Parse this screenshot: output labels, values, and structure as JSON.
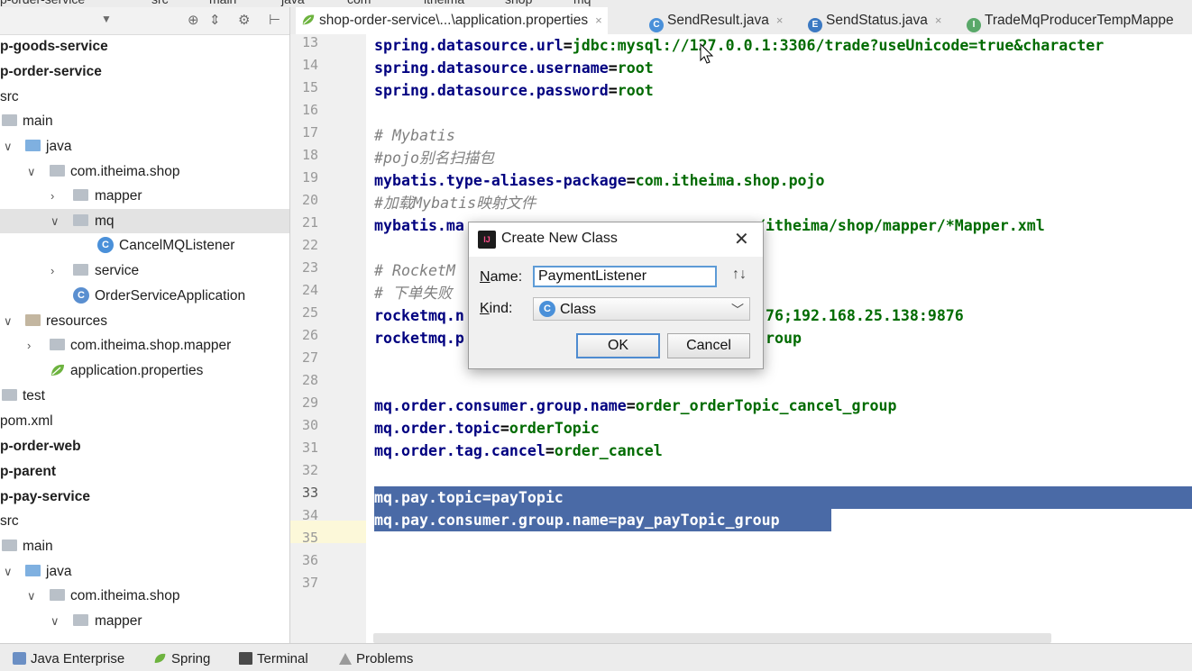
{
  "top_strip": {
    "crumbs": [
      "p-order-service",
      "src",
      "main",
      "java",
      "com",
      "itheima",
      "shop",
      "mq"
    ]
  },
  "project": {
    "tree": [
      {
        "label": "p-goods-service",
        "bold": true
      },
      {
        "label": "p-order-service",
        "bold": true
      },
      {
        "label": "src"
      },
      {
        "label": "main"
      },
      {
        "label": "java"
      },
      {
        "label": "com.itheima.shop"
      },
      {
        "label": "mapper"
      },
      {
        "label": "mq"
      },
      {
        "label": "CancelMQListener"
      },
      {
        "label": "service"
      },
      {
        "label": "OrderServiceApplication"
      },
      {
        "label": "resources"
      },
      {
        "label": "com.itheima.shop.mapper"
      },
      {
        "label": "application.properties"
      },
      {
        "label": "test"
      },
      {
        "label": "pom.xml"
      },
      {
        "label": "p-order-web",
        "bold": true
      },
      {
        "label": "p-parent",
        "bold": true
      },
      {
        "label": "p-pay-service",
        "bold": true
      },
      {
        "label": "src"
      },
      {
        "label": "main"
      },
      {
        "label": "java"
      },
      {
        "label": "com.itheima.shop"
      },
      {
        "label": "mapper"
      }
    ]
  },
  "editor_tabs": [
    {
      "label": "shop-order-service\\...\\application.properties",
      "close": "×"
    },
    {
      "label": "SendResult.java",
      "close": "×"
    },
    {
      "label": "SendStatus.java",
      "close": "×"
    },
    {
      "label": "TradeMqProducerTempMappe"
    }
  ],
  "gutter": {
    "lines": [
      "13",
      "14",
      "15",
      "16",
      "17",
      "18",
      "19",
      "20",
      "21",
      "22",
      "23",
      "24",
      "25",
      "26",
      "27",
      "28",
      "29",
      "30",
      "31",
      "32",
      "33",
      "34",
      "35",
      "36",
      "37"
    ]
  },
  "code": {
    "l13": {
      "k": "spring.datasource.url",
      "e": "=",
      "v": "jdbc:mysql://127.0.0.1:3306/trade?useUnicode=true&character"
    },
    "l14": {
      "k": "spring.datasource.username",
      "e": "=",
      "v": "root"
    },
    "l15": {
      "k": "spring.datasource.password",
      "e": "=",
      "v": "root"
    },
    "l17": "# Mybatis",
    "l18": "#pojo别名扫描包",
    "l19": {
      "k": "mybatis.type-aliases-package",
      "e": "=",
      "v": "com.itheima.shop.pojo"
    },
    "l20": "#加载Mybatis映射文件",
    "l21a": "mybatis.ma",
    "l21b": "/itheima/shop/mapper/*Mapper.xml",
    "l23": "# RocketM",
    "l24": "# 下单失败",
    "l25a": "rocketmq.n",
    "l25b": "76;192.168.25.138:9876",
    "l26a": "rocketmq.p",
    "l26b": "roup",
    "l29": {
      "k": "mq.order.consumer.group.name",
      "e": "=",
      "v": "order_orderTopic_cancel_group"
    },
    "l30": {
      "k": "mq.order.topic",
      "e": "=",
      "v": "orderTopic"
    },
    "l31": {
      "k": "mq.order.tag.cancel",
      "e": "=",
      "v": "order_cancel"
    },
    "l33": "mq.pay.topic=payTopic",
    "l34": "mq.pay.consumer.group.name=pay_payTopic_group"
  },
  "dialog": {
    "title": "Create New Class",
    "name_label": "ame:",
    "name_mnemonic": "N",
    "name_value": "PaymentListener",
    "kind_label": "ind:",
    "kind_mnemonic": "K",
    "kind_value": "Class",
    "ok_label": "OK",
    "cancel_label": "Cancel",
    "class_badge": "C"
  },
  "bottom_bar": {
    "items": [
      "Java Enterprise",
      "Spring",
      "Terminal",
      "Problems"
    ]
  }
}
